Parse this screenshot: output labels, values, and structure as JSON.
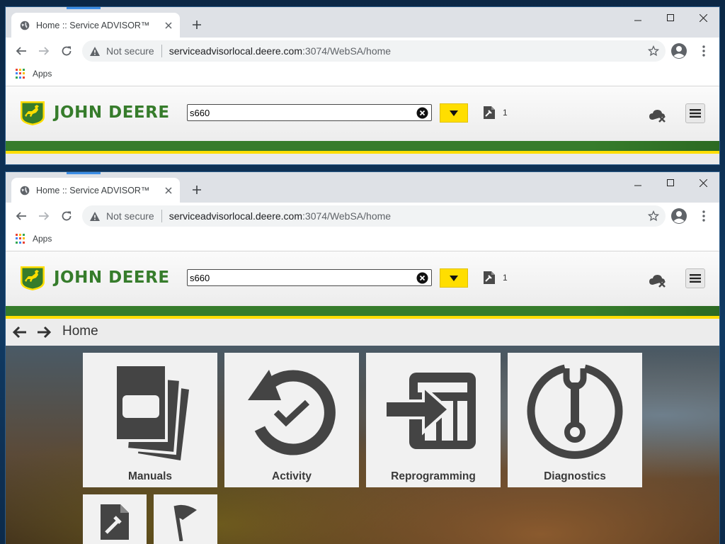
{
  "browser": {
    "tab_title": "Home :: Service ADVISOR™",
    "security_label": "Not secure",
    "url_host": "serviceadvisorlocal.deere.com",
    "url_path": ":3074/WebSA/home",
    "bookmarks_apps": "Apps"
  },
  "app": {
    "brand": "JOHN DEERE",
    "search_value": "s660",
    "tool_count": "1",
    "breadcrumb": "Home",
    "colors": {
      "green": "#367c2b",
      "yellow": "#ffde00"
    }
  },
  "tiles": [
    {
      "label": "Manuals",
      "icon": "manuals-icon"
    },
    {
      "label": "Activity",
      "icon": "activity-icon"
    },
    {
      "label": "Reprogramming",
      "icon": "reprogramming-icon"
    },
    {
      "label": "Diagnostics",
      "icon": "diagnostics-icon"
    },
    {
      "label": "",
      "icon": "tools-icon"
    },
    {
      "label": "",
      "icon": "flag-icon"
    }
  ]
}
